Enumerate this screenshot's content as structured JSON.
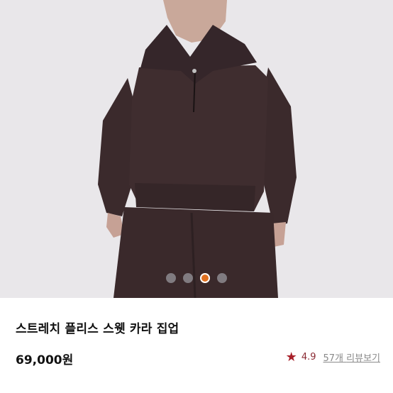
{
  "product": {
    "title": "스트레치 플리스 스웻 카라 집업",
    "price": "69,000원",
    "rating": "4.9",
    "review_count_label": "57개",
    "review_link_label": "리뷰보기"
  },
  "gallery": {
    "total_images": 4,
    "active_index": 2
  },
  "colors": {
    "garment": "#3e2c2e",
    "active_dot": "#e07020",
    "star": "#a8202a"
  }
}
